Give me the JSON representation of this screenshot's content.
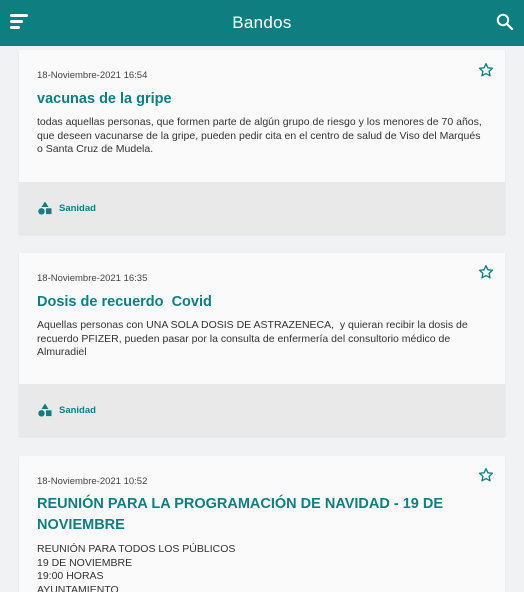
{
  "header": {
    "title": "Bandos",
    "menu_icon": "hamburger-menu-icon",
    "search_icon": "search-icon"
  },
  "colors": {
    "accent": "#0e7e80",
    "background": "#f1f2f4",
    "card": "#fafafb",
    "card_footer": "#e9e9ea"
  },
  "bandos": [
    {
      "date": "18-Noviembre-2021 16:54",
      "title": "vacunas de la gripe",
      "body": "todas aquellas personas, que formen parte de algún grupo de riesgo y los menores de 70 años, que deseen vacunarse de la gripe, pueden pedir cita en el centro de salud de Viso del Marqués o Santa Cruz de Mudela.",
      "category": "Sanidad"
    },
    {
      "date": "18-Noviembre-2021 16:35",
      "title": "Dosis de recuerdo  Covid",
      "body": "Aquellas personas con UNA SOLA DOSIS DE ASTRAZENECA,  y quieran recibir la dosis de recuerdo PFIZER, pueden pasar por la consulta de enfermería del consultorio médico de  Almuradiel",
      "category": "Sanidad"
    },
    {
      "date": "18-Noviembre-2021 10:52",
      "title": "REUNIÓN PARA LA PROGRAMACIÓN DE NAVIDAD - 19 DE NOVIEMBRE",
      "body_lines": [
        "REUNIÓN PARA TODOS LOS PÚBLICOS",
        "19 DE NOVIEMBRE",
        "19:00 HORAS",
        "AYUNTAMIENTO"
      ]
    }
  ]
}
